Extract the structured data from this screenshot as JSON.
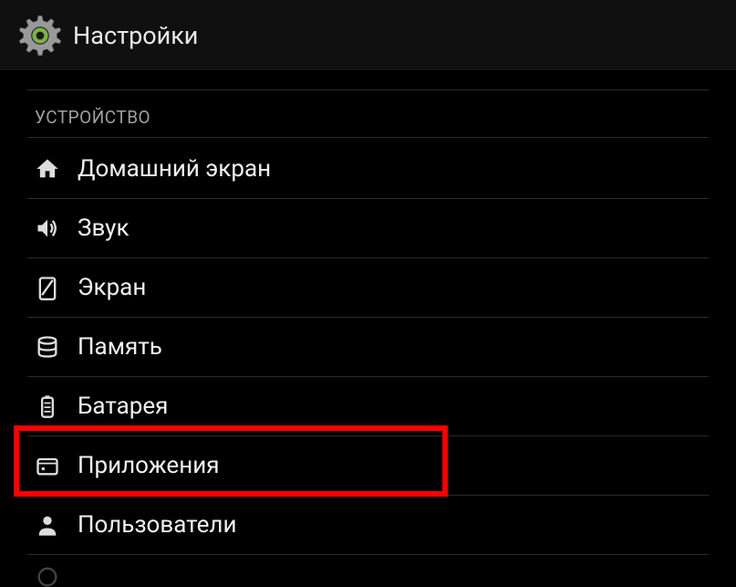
{
  "header": {
    "title": "Настройки"
  },
  "section": {
    "header": "УСТРОЙСТВО"
  },
  "items": {
    "home": "Домашний экран",
    "sound": "Звук",
    "display": "Экран",
    "memory": "Память",
    "battery": "Батарея",
    "apps": "Приложения",
    "users": "Пользователи"
  }
}
